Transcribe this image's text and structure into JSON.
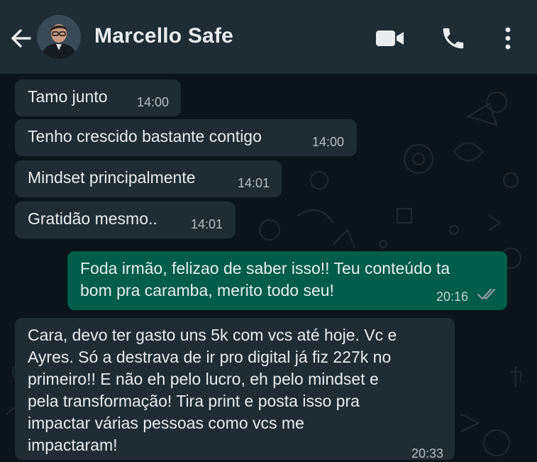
{
  "header": {
    "contact_name": "Marcello Safe",
    "back_icon": "arrow-left-icon",
    "video_icon": "video-camera-icon",
    "call_icon": "phone-icon",
    "menu_icon": "more-vertical-icon",
    "bg_color": "#1f2c34"
  },
  "colors": {
    "chat_bg": "#0b141a",
    "incoming": "#1f2c34",
    "outgoing": "#005c4b",
    "read_ticks": "#8696a0"
  },
  "messages": [
    {
      "text": "Tamo junto",
      "time": "14:00"
    },
    {
      "text": "Tenho crescido bastante contigo",
      "time": "14:00"
    },
    {
      "text": "Mindset principalmente",
      "time": "14:01"
    },
    {
      "text": "Gratidão mesmo..",
      "time": "14:01"
    },
    {
      "lines": [
        "Foda irmão, felizao de saber isso!! Teu conteúdo ta",
        "bom pra caramba, merito todo seu!"
      ],
      "time": "20:16"
    },
    {
      "lines": [
        "Cara, devo ter gasto uns 5k com vcs até hoje. Vc e",
        "Ayres. Só a destrava de ir pro digital já fiz 227k no",
        "primeiro!! E não eh pelo lucro, eh pelo mindset e",
        "pela transformação! Tira print e posta isso pra",
        "impactar várias pessoas como vcs me",
        "impactaram!"
      ],
      "time": "20:33"
    }
  ]
}
